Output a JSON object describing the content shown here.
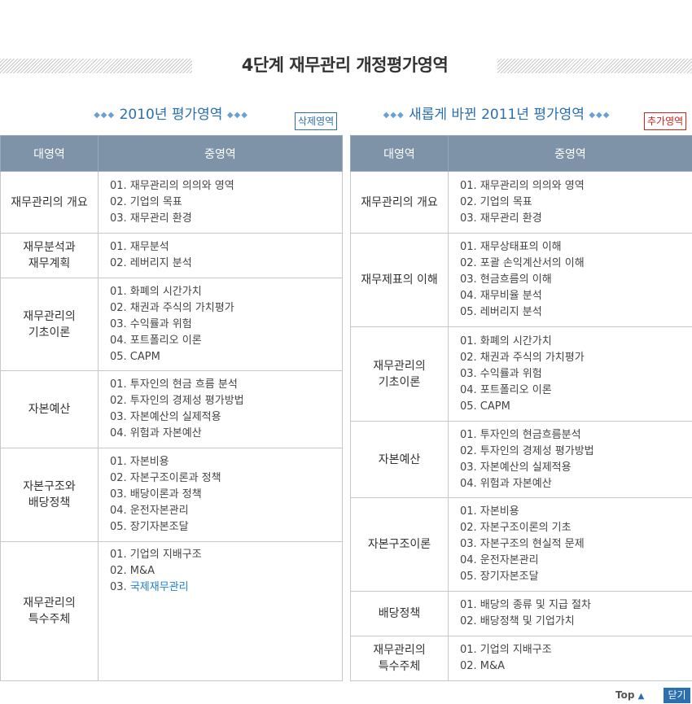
{
  "page": {
    "title": "4단계 재무관리 개정평가영역",
    "footer": {
      "top_label": "Top",
      "close_label": "닫기"
    }
  },
  "icons": {
    "diamond": "diamond-icon",
    "up_arrow": "triangle-up-icon"
  },
  "colors": {
    "header_bg": "#7e93a8",
    "accent_blue": "#2a6fb0",
    "accent_red": "#d0221b",
    "highlight": "#1f7fd1"
  },
  "col2010": {
    "title": "2010년 평가영역",
    "badge": "삭제영역",
    "headers": {
      "major": "대영역",
      "sub": "중영역"
    },
    "rows": [
      {
        "major": "재무관리의 개요",
        "items": [
          "01. 재무관리의 의의와 영역",
          "02. 기업의 목표",
          "03. 재무관리 환경"
        ]
      },
      {
        "major": "재무분석과\n재무계획",
        "items": [
          "01. 재무분석",
          "02. 레버리지 분석"
        ]
      },
      {
        "major": "재무관리의\n기초이론",
        "items": [
          "01. 화폐의 시간가치",
          "02. 채권과 주식의 가치평가",
          "03. 수익률과 위험",
          "04. 포트폴리오 이론",
          "05. CAPM"
        ]
      },
      {
        "major": "자본예산",
        "items": [
          "01. 투자인의 현금 흐름 분석",
          "02. 투자인의 경제성 평가방법",
          "03. 자본예산의 실제적용",
          "04. 위험과 자본예산"
        ]
      },
      {
        "major": "자본구조와\n배당정책",
        "items": [
          "01. 자본비용",
          "02. 자본구조이론과 정책",
          "03. 배당이론과 정책",
          "04. 운전자본관리",
          "05. 장기자본조달"
        ]
      },
      {
        "major": "재무관리의\n특수주체",
        "items": [
          "01. 기업의 지배구조",
          "02. M&A"
        ],
        "item_prefix": "03. ",
        "highlight_item": "국제재무관리"
      }
    ]
  },
  "col2011": {
    "title": "새롭게 바뀐 2011년 평가영역",
    "badge": "추가영역",
    "headers": {
      "major": "대영역",
      "sub": "중영역"
    },
    "rows": [
      {
        "major": "재무관리의 개요",
        "items": [
          "01. 재무관리의 의의와 영역",
          "02. 기업의 목표",
          "03. 재무관리 환경"
        ]
      },
      {
        "major": "재무제표의 이해",
        "items": [
          "01. 재무상태표의 이해",
          "02. 포괄 손익계산서의 이해",
          "03. 현금흐름의 이해",
          "04. 재무비율 분석",
          "05. 레버리지 분석"
        ]
      },
      {
        "major": "재무관리의\n기초이론",
        "items": [
          "01. 화폐의 시간가치",
          "02. 채권과 주식의 가치평가",
          "03. 수익률과 위험",
          "04. 포트폴리오 이론",
          "05. CAPM"
        ]
      },
      {
        "major": "자본예산",
        "items": [
          "01. 투자인의 현금흐름분석",
          "02. 투자인의 경제성 평가방법",
          "03. 자본예산의 실제적용",
          "04. 위험과 자본예산"
        ]
      },
      {
        "major": "자본구조이론",
        "items": [
          "01. 자본비용",
          "02. 자본구조이론의 기초",
          "03. 자본구조의 현실적 문제",
          "04. 운전자본관리",
          "05. 장기자본조달"
        ]
      },
      {
        "major": "배당정책",
        "items": [
          "01. 배당의 종류 및 지급 절차",
          "02. 배당정책 및 기업가치"
        ]
      },
      {
        "major": "재무관리의\n특수주체",
        "items": [
          "01. 기업의 지배구조",
          "02. M&A"
        ]
      }
    ]
  }
}
